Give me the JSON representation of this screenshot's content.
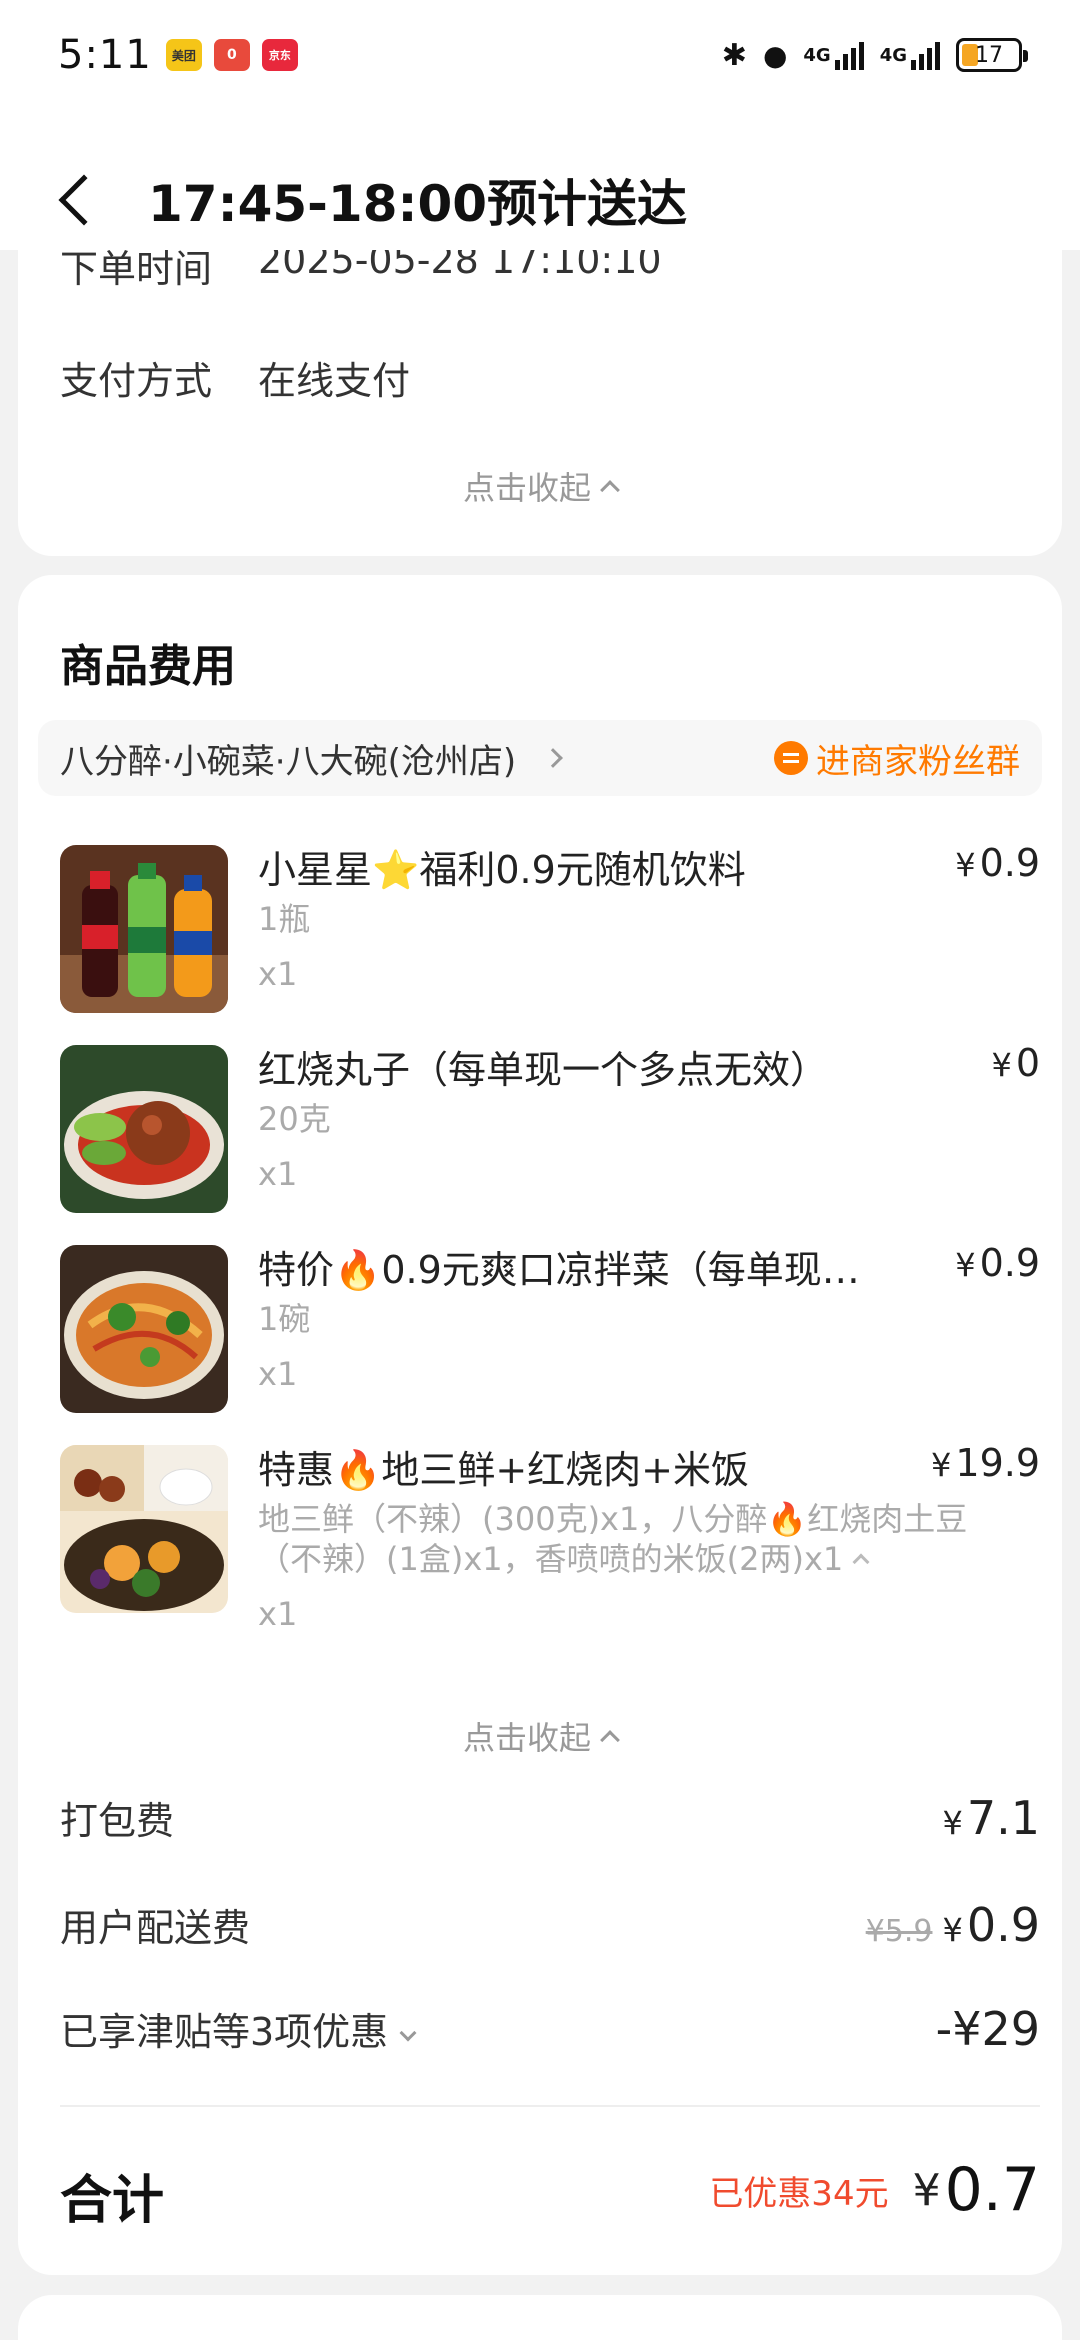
{
  "status": {
    "time": "5:11",
    "apps": [
      {
        "name": "meituan-icon",
        "label": "美团",
        "color": "#f5c518"
      },
      {
        "name": "notification-icon",
        "label": "0",
        "color": "#e84a3c"
      },
      {
        "name": "jd-icon",
        "label": "京东",
        "color": "#e8283c"
      }
    ],
    "network1": "4G",
    "network2": "4G",
    "battery": "17"
  },
  "header": {
    "title": "17:45-18:00预计送达"
  },
  "order_info": {
    "order_time_label": "下单时间",
    "order_time_value": "2025-05-28 17:10:10",
    "pay_label": "支付方式",
    "pay_value": "在线支付",
    "collapse": "点击收起"
  },
  "goods": {
    "title": "商品费用",
    "store_name": "八分醉·小碗菜·八大碗(沧州店)",
    "fans_group": "进商家粉丝群",
    "items": [
      {
        "name_pre": "小星星",
        "name_post": "福利0.9元随机饮料",
        "icon": "star",
        "spec": "1瓶",
        "qty": "x1",
        "price": "0.9"
      },
      {
        "name_pre": "红烧丸子（每单现一个多点无效）",
        "name_post": "",
        "icon": "",
        "spec": "20克",
        "qty": "x1",
        "price": "0"
      },
      {
        "name_pre": "特价",
        "name_post": "0.9元爽口凉拌菜（每单现…",
        "icon": "fire",
        "spec": "1碗",
        "qty": "x1",
        "price": "0.9"
      },
      {
        "name_pre": "特惠",
        "name_post": "地三鲜+红烧肉+米饭",
        "icon": "fire",
        "spec": "地三鲜（不辣）(300克)x1，八分醉🔥红烧肉土豆（不辣）(1盒)x1，香喷喷的米饭(2两)x1",
        "qty": "x1",
        "price": "19.9"
      }
    ],
    "collapse": "点击收起"
  },
  "fees": {
    "pack_label": "打包费",
    "pack_value": "7.1",
    "delivery_label": "用户配送费",
    "delivery_original": "¥5.9",
    "delivery_value": "0.9",
    "discount_label": "已享津贴等3项优惠",
    "discount_value": "-¥29",
    "total_label": "合计",
    "saved": "已优惠34元",
    "total_value": "0.7",
    "currency": "¥"
  },
  "colors": {
    "accent_orange": "#ff7a00",
    "discount_red": "#f04b2e"
  }
}
